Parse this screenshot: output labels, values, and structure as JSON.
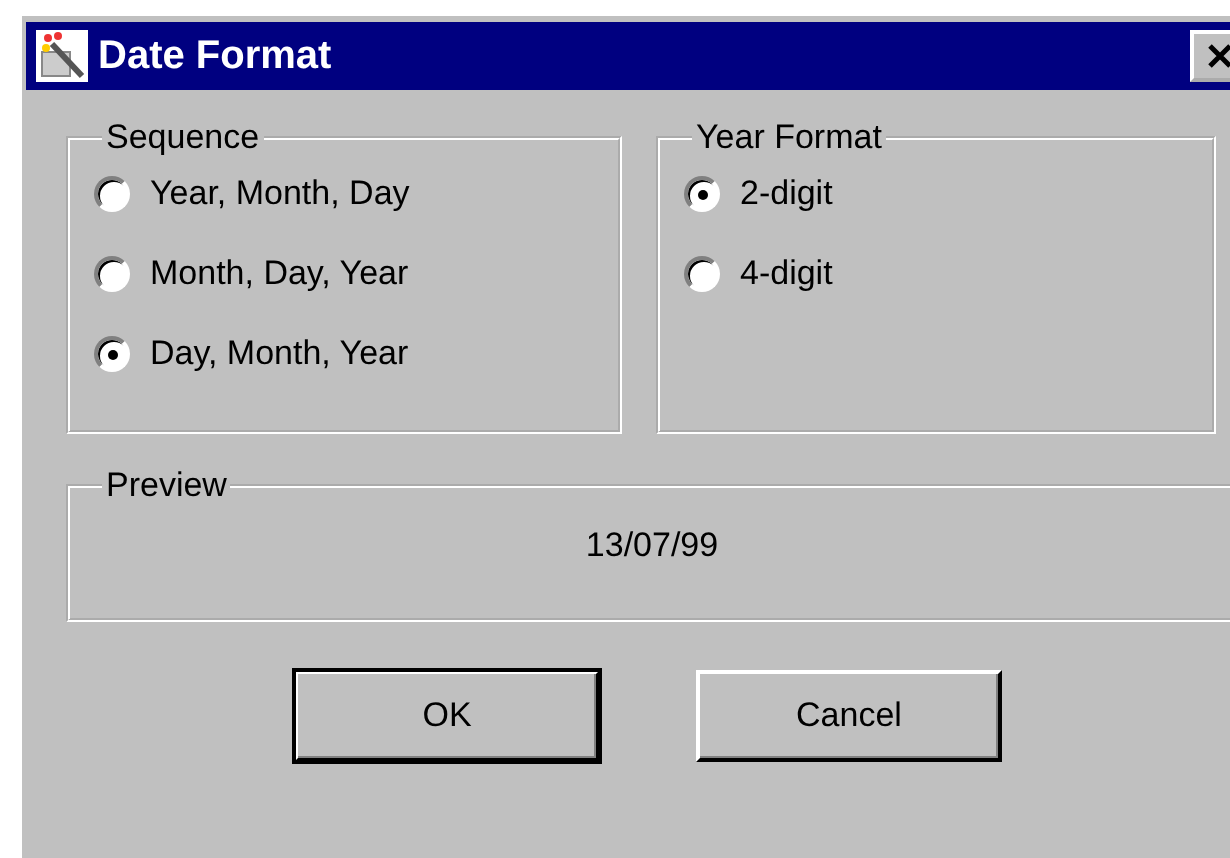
{
  "window": {
    "title": "Date Format"
  },
  "groups": [
    {
      "title": "Sequence",
      "options": [
        {
          "label": "Year, Month, Day",
          "selected": false
        },
        {
          "label": "Month, Day, Year",
          "selected": false
        },
        {
          "label": "Day, Month, Year",
          "selected": true
        }
      ]
    },
    {
      "title": "Year Format",
      "options": [
        {
          "label": "2-digit",
          "selected": true
        },
        {
          "label": "4-digit",
          "selected": false
        }
      ]
    }
  ],
  "preview": {
    "title": "Preview",
    "value": "13/07/99"
  },
  "buttons": [
    {
      "label": "OK",
      "default": true
    },
    {
      "label": "Cancel",
      "default": false
    }
  ]
}
